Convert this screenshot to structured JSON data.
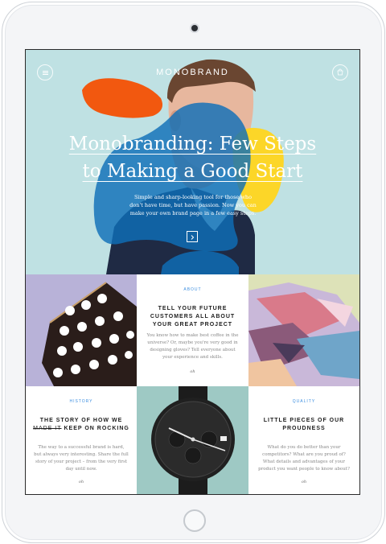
{
  "app": {
    "brand": "MONOBRAND"
  },
  "hero": {
    "title_line1": "Monobranding: Few Steps",
    "title_line2": "to Making a Good Start",
    "text": "Simple and sharp-looking tool for those who don't have time, but have passion. Now you can make your own brand page in a few easy steps.",
    "arrow_icon": "chevron-right-icon"
  },
  "cards": {
    "about": {
      "label": "ABOUT",
      "title": "TELL YOUR FUTURE CUSTOMERS ALL ABOUT YOUR GREAT PROJECT",
      "text": "You know how to make best coffee in the universe? Or, maybe you're very good in designing gloves? Tell everyone about your experience and skills.",
      "signature": "oh"
    },
    "history": {
      "label": "HISTORY",
      "title_before": "THE STORY OF HOW WE",
      "title_strike": "MADE IT",
      "title_after": "KEEP ON ROCKING",
      "text": "The way to a successful brand is hard, but always very interesting. Share the full story of your project – from the very first day until now.",
      "signature": "oh"
    },
    "quality": {
      "label": "QUALITY",
      "title": "LITTLE PIECES OF OUR PROUDNESS",
      "text": "What do you do better than your competitors? What are you proud of? What details and advantages of your product you want people to know about?",
      "signature": "oh"
    }
  },
  "colors": {
    "hero_bg": "#bfe1e3",
    "blob_orange": "#f2580f",
    "blob_blue": "#0f6fb8",
    "blob_yellow": "#ffd51e",
    "accent_label": "#3d8fe0"
  }
}
